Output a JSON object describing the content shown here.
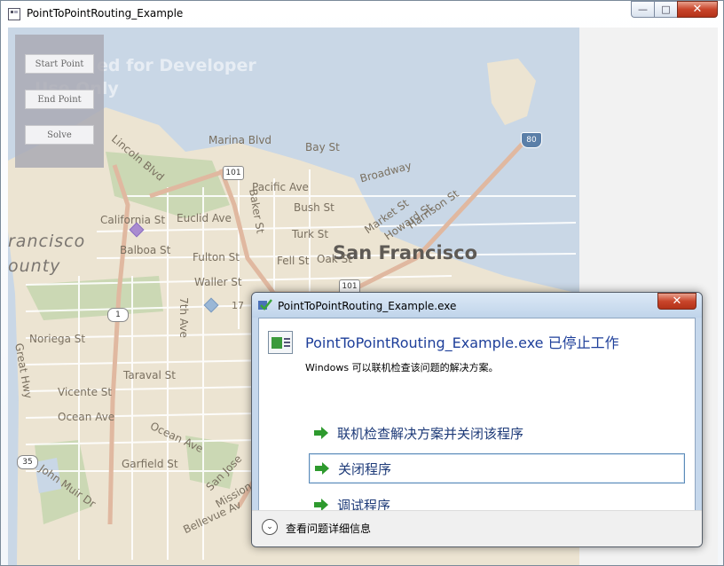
{
  "window": {
    "title": "PointToPointRouting_Example",
    "min_symbol": "—",
    "max_symbol": "□",
    "close_symbol": "✕"
  },
  "panel": {
    "start_point_label": "Start Point",
    "end_point_label": "End Point",
    "solve_label": "Solve"
  },
  "map": {
    "watermark_line1": "ed for Developer",
    "watermark_line2": "Use Only",
    "city_label": "San Francisco",
    "region_label1": "rancisco",
    "region_label2": "ounty",
    "streets": [
      "Lincoln Blvd",
      "Marina Blvd",
      "Bay St",
      "Broadway",
      "Pacific Ave",
      "Bush St",
      "California St",
      "Euclid Ave",
      "Baker St",
      "Turk St",
      "Market St",
      "Howard St",
      "Harrison St",
      "Balboa St",
      "Fulton St",
      "Fell St",
      "Oak St",
      "Waller St",
      "7th Ave",
      "Noriega St",
      "Taraval St",
      "Vicente St",
      "Ocean Ave",
      "Garfield St",
      "John Muir Dr",
      "Bellevue Av",
      "Great Hwy",
      "Mission",
      "San Jose"
    ],
    "shields": [
      "101",
      "1",
      "80",
      "35",
      "101",
      "17"
    ],
    "colors": {
      "water": "#c9d7e6",
      "land": "#ece4d2",
      "park": "#cbd8b4",
      "highway": "#e0b8a0",
      "marker_start": "#a98bd0",
      "marker_end": "#9ab7d6"
    }
  },
  "dialog": {
    "title": "PointToPointRouting_Example.exe",
    "close_symbol": "✕",
    "headline": "PointToPointRouting_Example.exe 已停止工作",
    "subtext": "Windows 可以联机检查该问题的解决方案。",
    "commands": [
      {
        "label": "联机检查解决方案并关闭该程序"
      },
      {
        "label": "关闭程序"
      },
      {
        "label": "调试程序"
      }
    ],
    "details_label": "查看问题详细信息",
    "details_symbol": "⌄"
  }
}
